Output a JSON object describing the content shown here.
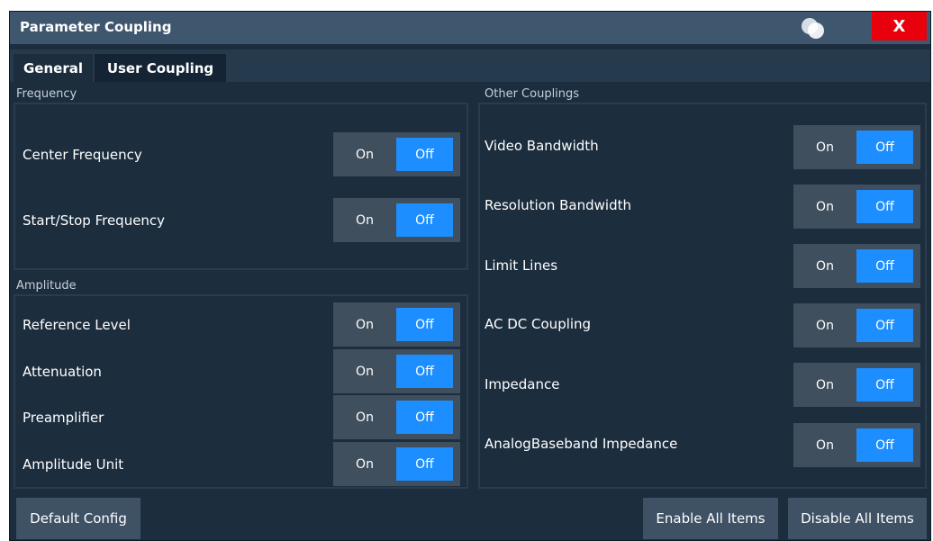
{
  "window": {
    "title": "Parameter Coupling",
    "close_label": "X"
  },
  "tabs": [
    {
      "label": "General",
      "active": true
    },
    {
      "label": "User Coupling",
      "active": false
    }
  ],
  "frequency": {
    "label": "Frequency",
    "items": [
      {
        "label": "Center Frequency",
        "on": "On",
        "off": "Off",
        "state": "Off"
      },
      {
        "label": "Start/Stop Frequency",
        "on": "On",
        "off": "Off",
        "state": "Off"
      }
    ]
  },
  "amplitude": {
    "label": "Amplitude",
    "items": [
      {
        "label": "Reference Level",
        "on": "On",
        "off": "Off",
        "state": "Off"
      },
      {
        "label": "Attenuation",
        "on": "On",
        "off": "Off",
        "state": "Off"
      },
      {
        "label": "Preamplifier",
        "on": "On",
        "off": "Off",
        "state": "Off"
      },
      {
        "label": "Amplitude Unit",
        "on": "On",
        "off": "Off",
        "state": "Off"
      }
    ]
  },
  "other": {
    "label": "Other Couplings",
    "items": [
      {
        "label": "Video Bandwidth",
        "on": "On",
        "off": "Off",
        "state": "Off"
      },
      {
        "label": "Resolution Bandwidth",
        "on": "On",
        "off": "Off",
        "state": "Off"
      },
      {
        "label": "Limit Lines",
        "on": "On",
        "off": "Off",
        "state": "Off"
      },
      {
        "label": "AC DC Coupling",
        "on": "On",
        "off": "Off",
        "state": "Off"
      },
      {
        "label": "Impedance",
        "on": "On",
        "off": "Off",
        "state": "Off"
      },
      {
        "label": "AnalogBaseband Impedance",
        "on": "On",
        "off": "Off",
        "state": "Off"
      }
    ]
  },
  "buttons": {
    "default_config": "Default Config",
    "enable_all": "Enable All Items",
    "disable_all": "Disable All Items"
  },
  "colors": {
    "selected": "#1d8eff",
    "close": "#e8000d",
    "title_bar": "#3e566e",
    "background": "#1c2d3e"
  }
}
